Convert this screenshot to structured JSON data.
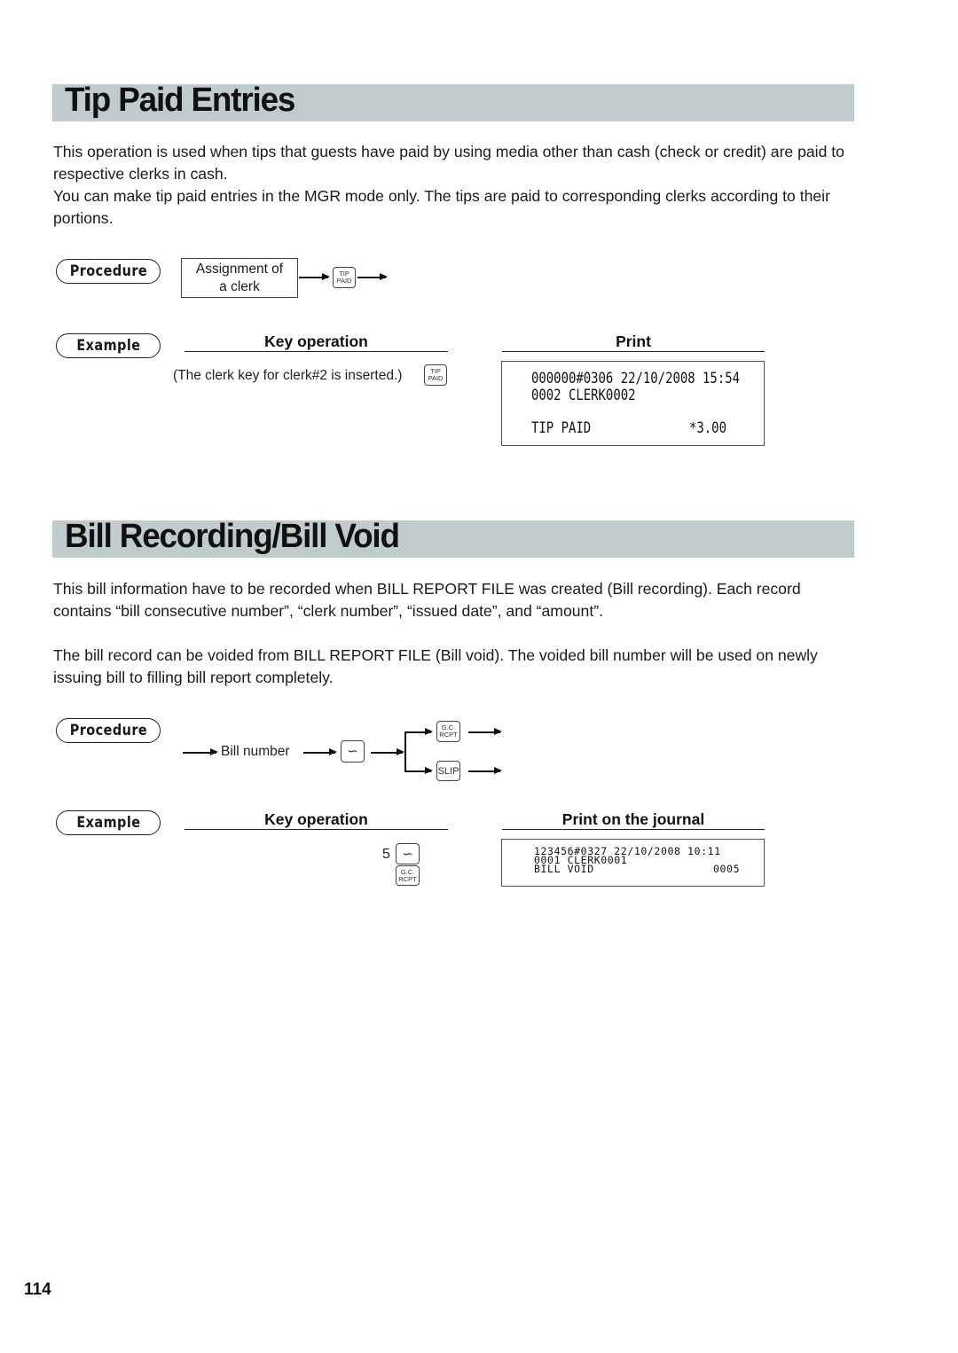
{
  "sections": [
    {
      "title": "Tip Paid Entries",
      "paragraphs": [
        "This operation is used when tips that guests have paid by using media other than cash (check or credit) are paid to respective clerks in cash.",
        "You can make tip paid entries in the MGR mode only. The tips are paid to corresponding clerks according to their portions."
      ],
      "procedure": {
        "label": "Procedure",
        "step_box": [
          "Assignment of",
          "a clerk"
        ],
        "key": [
          "TIP",
          "PAID"
        ]
      },
      "example": {
        "label": "Example",
        "key_operation_heading": "Key operation",
        "print_heading": "Print",
        "key_operation_text": "(The clerk key for clerk#2 is inserted.)",
        "key": [
          "TIP",
          "PAID"
        ],
        "receipt": {
          "line1": "000000#0306 22/10/2008 15:54",
          "line2": "0002 CLERK0002",
          "line3_label": "TIP PAID",
          "line3_value": "*3.00"
        }
      }
    },
    {
      "title": "Bill Recording/Bill Void",
      "paragraphs": [
        "This bill information have to be recorded when BILL REPORT FILE was created (Bill recording).  Each record contains “bill consecutive number”, “clerk number”, “issued date”, and “amount”.",
        "The bill record can be voided from BILL REPORT FILE (Bill void).  The voided bill number will be used on newly issuing bill to filling bill report completely."
      ],
      "procedure": {
        "label": "Procedure",
        "step_text": "Bill number",
        "key_loop": "∽",
        "branch_key_1": [
          "G.C.",
          "RCPT"
        ],
        "branch_key_2": "SLIP"
      },
      "example": {
        "label": "Example",
        "key_operation_heading": "Key operation",
        "print_heading": "Print on the journal",
        "entry_number": "5",
        "key_loop": "∽",
        "key_gc": [
          "G.C.",
          "RCPT"
        ],
        "journal": {
          "line1": "123456#0327 22/10/2008 10:11",
          "line2": "0001 CLERK0001",
          "line3_label": "BILL VOID",
          "line3_value": "0005"
        }
      }
    }
  ],
  "page_number": "114",
  "colors": {
    "section_bar": "#bfcbcc"
  }
}
